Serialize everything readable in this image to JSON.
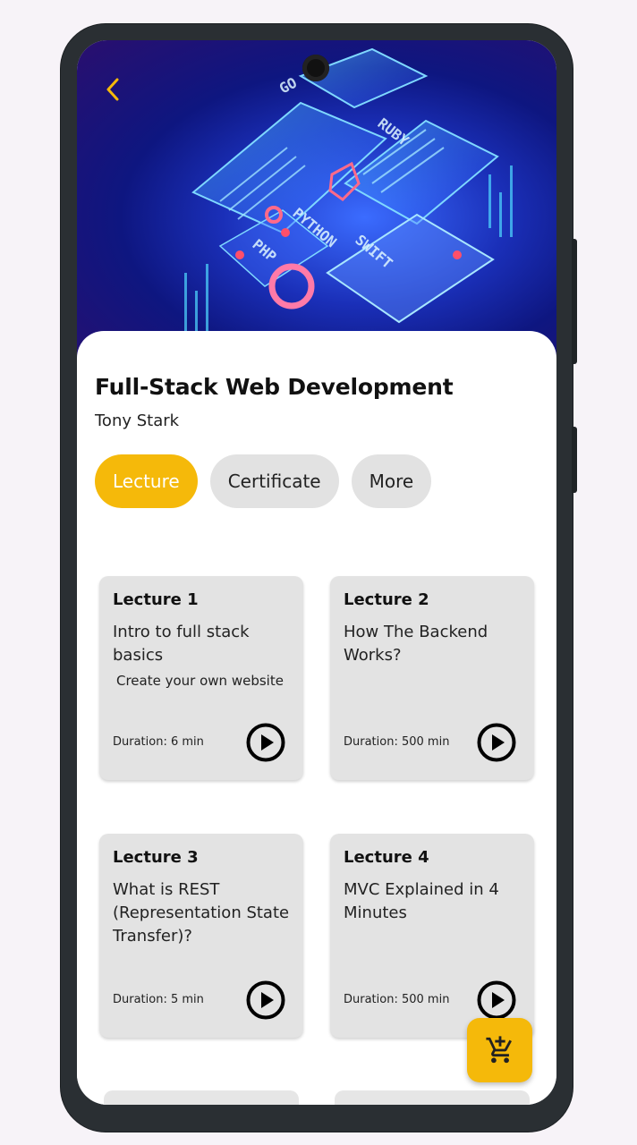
{
  "course": {
    "title": "Full-Stack Web Development",
    "author": "Tony Stark"
  },
  "tabs": [
    {
      "label": "Lecture",
      "active": true
    },
    {
      "label": "Certificate",
      "active": false
    },
    {
      "label": "More",
      "active": false
    }
  ],
  "lectures": [
    {
      "title": "Lecture 1",
      "description": "Intro to full stack basics",
      "subtitle": "Create your own website",
      "duration": "Duration: 6 min"
    },
    {
      "title": "Lecture 2",
      "description": "How The Backend Works?",
      "subtitle": "",
      "duration": "Duration: 500 min"
    },
    {
      "title": "Lecture 3",
      "description": "What is REST (Representation State Transfer)?",
      "subtitle": "",
      "duration": "Duration: 5 min"
    },
    {
      "title": "Lecture 4",
      "description": "MVC Explained in 4 Minutes",
      "subtitle": "",
      "duration": "Duration: 500 min"
    }
  ],
  "hero": {
    "words": [
      "GO",
      "RUBY",
      "PYTHON",
      "SWIFT",
      "PHP"
    ]
  },
  "icons": {
    "back": "chevron-left-icon",
    "play": "play-circle-icon",
    "cart": "add-shopping-cart-icon"
  },
  "colors": {
    "accent": "#f5b90a",
    "card": "#e3e3e3",
    "tab_inactive": "#e2e2e2"
  }
}
